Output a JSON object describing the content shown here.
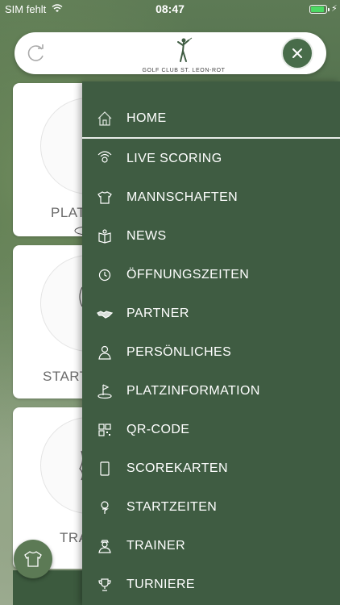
{
  "status_bar": {
    "carrier": "SIM fehlt",
    "time": "08:47",
    "battery_level": 0.9,
    "battery_color": "#4cd964"
  },
  "header": {
    "logo_text": "GOLF CLUB ST. LEON-ROT",
    "refresh_icon": "refresh-icon",
    "close_icon": "close-icon",
    "accent_color": "#486c4a"
  },
  "cards": [
    {
      "label": "PLAT"
    },
    {
      "label": "START"
    },
    {
      "label": "TRA"
    }
  ],
  "menu": {
    "background_color": "#3f5c42",
    "items": [
      {
        "label": "HOME",
        "icon": "home-icon"
      },
      {
        "label": "LIVE SCORING",
        "icon": "live-scoring-icon"
      },
      {
        "label": "MANNSCHAFTEN",
        "icon": "shirt-icon"
      },
      {
        "label": "NEWS",
        "icon": "news-icon"
      },
      {
        "label": "ÖFFNUNGSZEITEN",
        "icon": "clock-icon"
      },
      {
        "label": "PARTNER",
        "icon": "handshake-icon"
      },
      {
        "label": "PERSÖNLICHES",
        "icon": "person-icon"
      },
      {
        "label": "PLATZINFORMATION",
        "icon": "flag-icon"
      },
      {
        "label": "QR-CODE",
        "icon": "qr-code-icon"
      },
      {
        "label": "SCOREKARTEN",
        "icon": "scorecard-icon"
      },
      {
        "label": "STARTZEITEN",
        "icon": "tee-icon"
      },
      {
        "label": "TRAINER",
        "icon": "trainer-icon"
      },
      {
        "label": "TURNIERE",
        "icon": "trophy-icon"
      }
    ]
  }
}
